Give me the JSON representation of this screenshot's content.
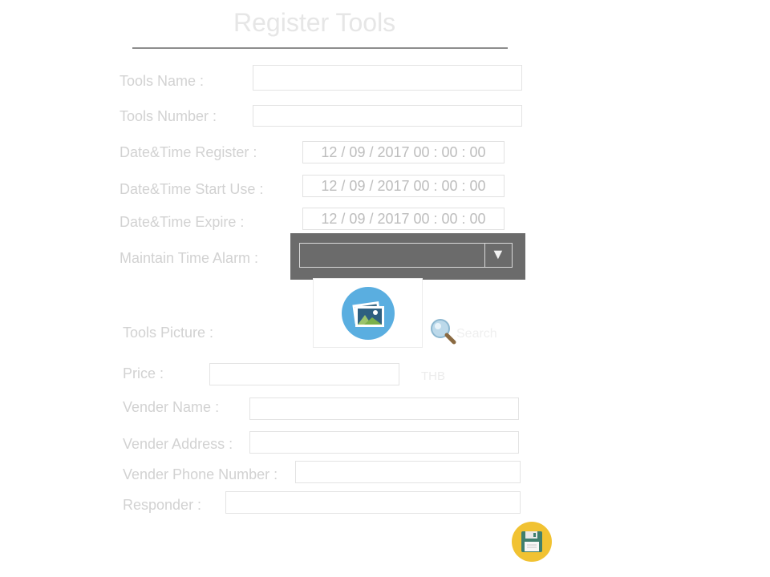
{
  "form": {
    "title": "Register Tools",
    "labels": {
      "tools_name": "Tools Name :",
      "tools_number": "Tools Number :",
      "datetime_register": "Date&Time Register  :",
      "datetime_start_use": "Date&Time Start Use :",
      "datetime_expire": "Date&Time Expire :",
      "maintain_time_alarm": "Maintain Time Alarm :",
      "tools_picture": "Tools Picture :",
      "price": "Price :",
      "vender_name": "Vender Name :",
      "vender_address": "Vender Address :",
      "vender_phone": "Vender Phone Number :",
      "responder": "Responder :"
    },
    "values": {
      "datetime_register": "12 / 09 / 2017  00 : 00 : 00",
      "datetime_start_use": "12 / 09 / 2017  00 : 00 : 00",
      "datetime_expire": "12 / 09 / 2017  00 : 00 : 00",
      "maintain_time_alarm": ""
    },
    "search_label": "Search",
    "currency": "THB",
    "icons": {
      "dropdown": "triangle-down-icon",
      "picture": "image-placeholder-icon",
      "search": "magnifier-icon",
      "save": "floppy-disk-icon"
    },
    "colors": {
      "dropdown_panel": "#6b6b6b",
      "save_button": "#f1c232",
      "picture_circle": "#5aaee0"
    }
  }
}
